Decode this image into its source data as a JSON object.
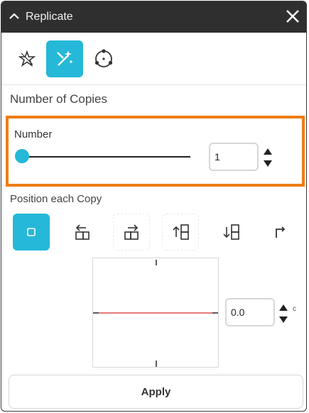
{
  "window": {
    "title": "Replicate"
  },
  "modes": [
    {
      "icon": "star-outline-icon",
      "active": false
    },
    {
      "icon": "magic-wand-sparkle-icon",
      "active": true
    },
    {
      "icon": "circle-points-icon",
      "active": false
    }
  ],
  "copies": {
    "section_title": "Number of Copies",
    "number_label": "Number",
    "slider_level": 0,
    "value": "1"
  },
  "position": {
    "label": "Position each Copy",
    "options": [
      {
        "icon": "center-square-icon",
        "active": true
      },
      {
        "icon": "align-left-arrow-icon",
        "active": false
      },
      {
        "icon": "align-right-arrow-icon",
        "active": false
      },
      {
        "icon": "align-up-arrow-icon",
        "active": false
      },
      {
        "icon": "align-down-arrow-icon",
        "active": false
      },
      {
        "icon": "corner-arrow-icon",
        "active": false
      }
    ],
    "offset_value": "0.0",
    "unit": "c"
  },
  "actions": {
    "apply_label": "Apply"
  },
  "colors": {
    "accent": "#25b8d8",
    "highlight": "#ee7d12",
    "title_bar": "#2f2f2f",
    "preview_line": "#e87a7a"
  }
}
